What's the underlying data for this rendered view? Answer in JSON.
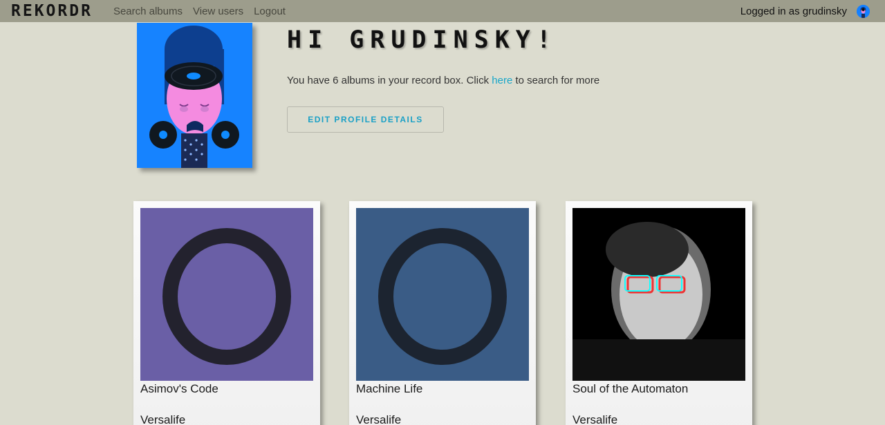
{
  "navbar": {
    "brand": "REKORDR",
    "links": [
      "Search albums",
      "View users",
      "Logout"
    ],
    "logged_in_text": "Logged in as grudinsky",
    "avatar_icon": "user-avatar-icon"
  },
  "profile": {
    "greeting": "HI GRUDINSKY!",
    "count_prefix": "You have 6 albums in your record box. Click ",
    "count_link": "here",
    "count_suffix": " to search for more",
    "edit_button": "EDIT PROFILE DETAILS"
  },
  "albums": [
    {
      "title": "Asimov's Code",
      "artist": "Versalife",
      "cover_color": "#6a5fa6"
    },
    {
      "title": "Machine Life",
      "artist": "Versalife",
      "cover_color": "#3a5c86"
    },
    {
      "title": "Soul of the Automaton",
      "artist": "Versalife",
      "cover_color": "#000000"
    }
  ],
  "colors": {
    "background": "#dcdccf",
    "navbar": "#9d9d8c",
    "accent": "#18a6c9"
  }
}
